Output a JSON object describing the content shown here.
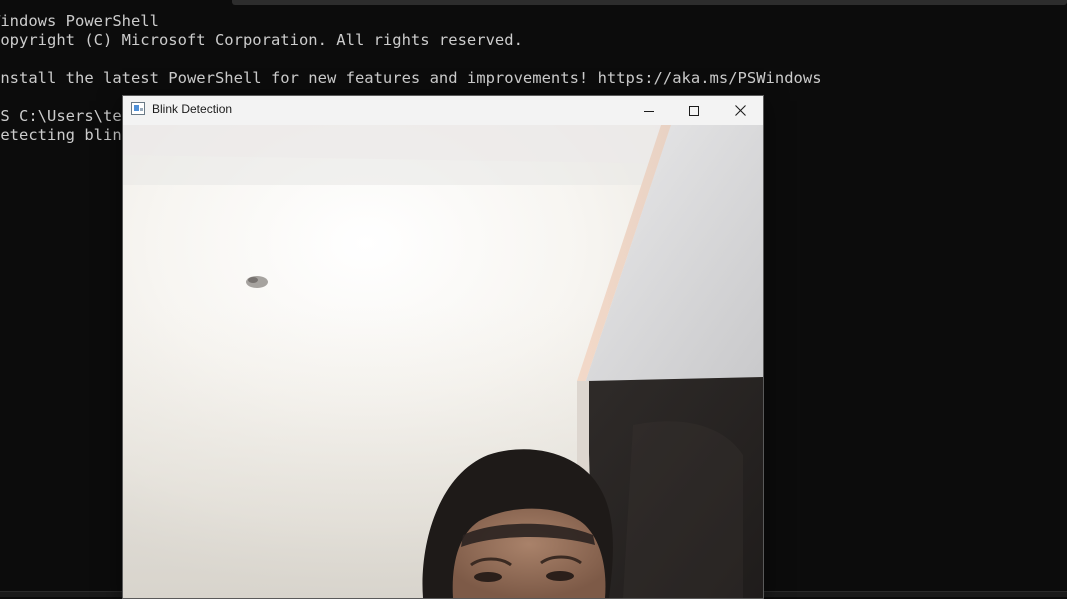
{
  "terminal": {
    "lines": [
      "Windows PowerShell",
      "Copyright (C) Microsoft Corporation. All rights reserved.",
      "",
      "Install the latest PowerShell for new features and improvements! https://aka.ms/PSWindows",
      "",
      "PS C:\\Users\\te",
      "Detecting blink"
    ]
  },
  "window": {
    "title": "Blink Detection",
    "controls": {
      "minimize_icon": "minimize-icon",
      "maximize_icon": "maximize-icon",
      "close_icon": "close-icon"
    }
  },
  "colors": {
    "terminal_bg": "#0c0c0c",
    "terminal_text": "#cccccc",
    "titlebar_bg": "#f3f3f3"
  }
}
